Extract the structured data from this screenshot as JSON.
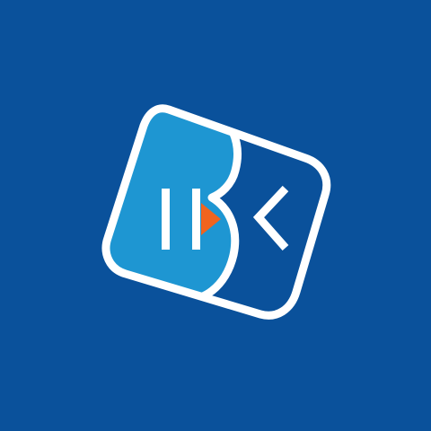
{
  "app": {
    "name": "IBK",
    "logo_icon": "ibk-logo-icon"
  },
  "colors": {
    "background": "#0A519B",
    "card_left": "#1E96D2",
    "card_right": "#0A519B",
    "outline": "#FFFFFF",
    "accent": "#F0641E"
  },
  "logo": {
    "parts": [
      "letter-i-icon",
      "letter-b-shape-icon",
      "letter-k-icon",
      "play-triangle-icon"
    ]
  }
}
